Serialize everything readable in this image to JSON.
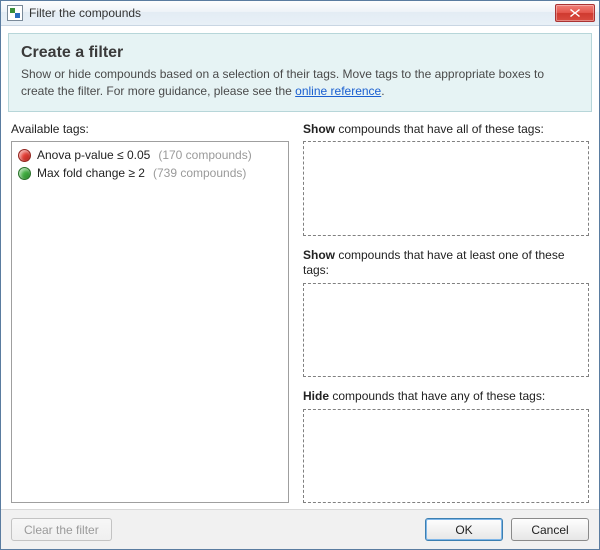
{
  "window": {
    "title": "Filter the compounds"
  },
  "banner": {
    "heading": "Create a filter",
    "text_before_link": "Show or hide compounds based on a selection of their tags. Move tags to the appropriate boxes to create the filter. For more guidance, please see the ",
    "link_text": "online reference",
    "text_after_link": "."
  },
  "labels": {
    "available": "Available tags:",
    "show_all_prefix": "Show",
    "show_all_rest": " compounds that have all of these tags:",
    "show_any_prefix": "Show",
    "show_any_rest": " compounds that have at least one of these tags:",
    "hide_prefix": "Hide",
    "hide_rest": " compounds that have any of these tags:"
  },
  "tags": [
    {
      "name": "Anova p-value ≤ 0.05",
      "count_text": "(170 compounds)",
      "color": "#e23b32"
    },
    {
      "name": "Max fold change ≥ 2",
      "count_text": "(739 compounds)",
      "color": "#3fae3f"
    }
  ],
  "buttons": {
    "clear": "Clear the filter",
    "ok": "OK",
    "cancel": "Cancel"
  }
}
